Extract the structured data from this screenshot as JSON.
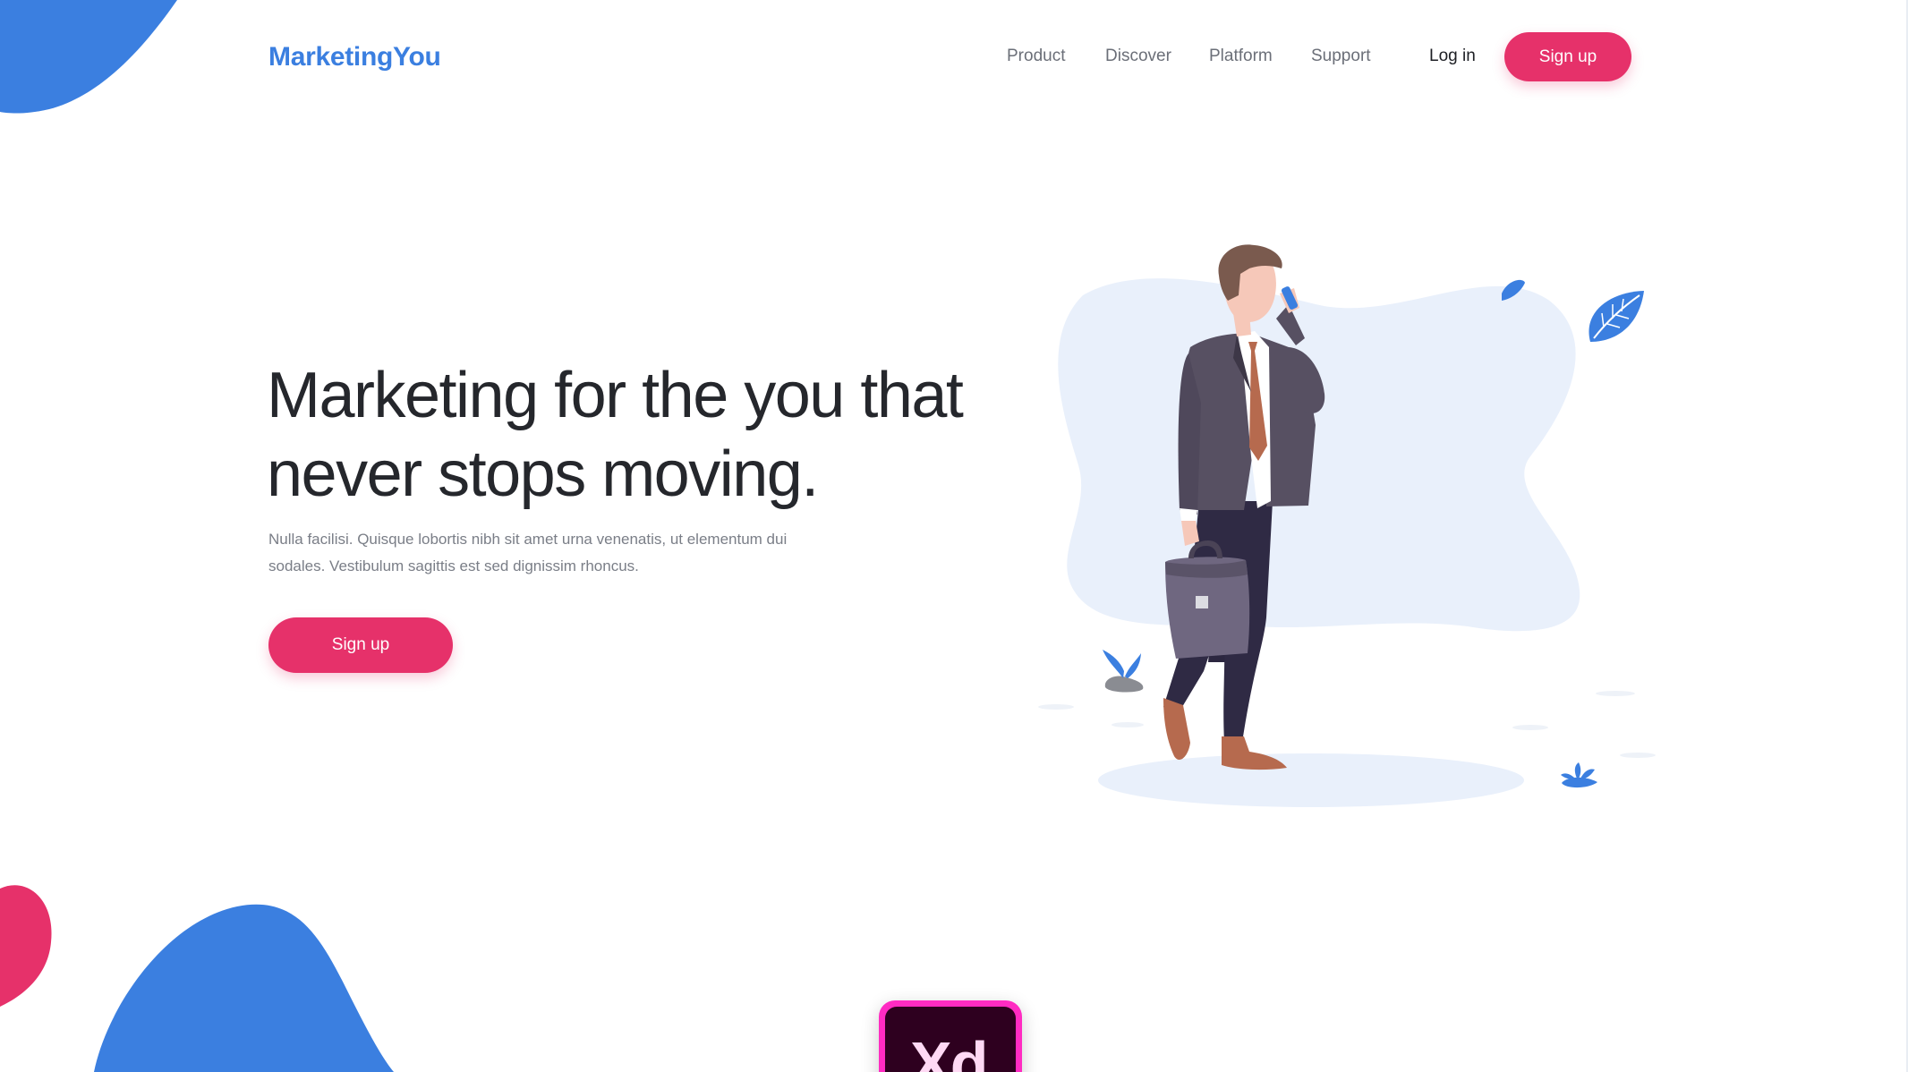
{
  "brand": {
    "name": "MarketingYou"
  },
  "nav": {
    "items": [
      {
        "label": "Product"
      },
      {
        "label": "Discover"
      },
      {
        "label": "Platform"
      },
      {
        "label": "Support"
      }
    ],
    "login_label": "Log in",
    "signup_label": "Sign up"
  },
  "hero": {
    "title_lines": [
      "Marketing for the you that",
      "never stops moving."
    ],
    "description_lines": [
      "Nulla facilisi. Quisque lobortis nibh sit amet urna venenatis, ut elementum dui",
      "sodales. Vestibulum sagittis est sed dignissim rhoncus."
    ],
    "cta_label": "Sign up"
  },
  "badge": {
    "text": "Xd"
  },
  "colors": {
    "brand_blue": "#3b7fe0",
    "accent_pink": "#e6316a",
    "title_text": "#25272c",
    "body_text": "#7a7e87",
    "nav_text": "#6b6f78",
    "illustration_bg": "#e9f0fb",
    "xd_pink": "#ff2bc2",
    "xd_dark": "#2e001f"
  },
  "icons": {
    "illustration": "businessman-walking-with-phone-and-briefcase",
    "leaves": "leaf-icon",
    "plant": "plant-icon",
    "badge": "adobe-xd-logo"
  }
}
